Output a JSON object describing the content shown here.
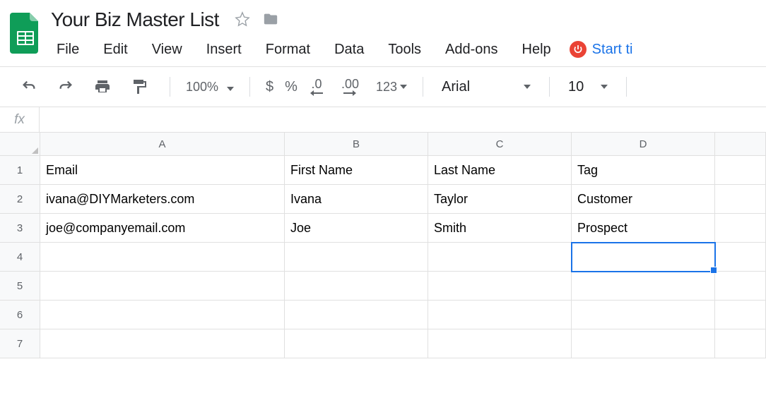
{
  "doc_title": "Your Biz Master List",
  "menubar": [
    "File",
    "Edit",
    "View",
    "Insert",
    "Format",
    "Data",
    "Tools",
    "Add-ons",
    "Help"
  ],
  "start_link": "Start ti",
  "toolbar": {
    "zoom": "100%",
    "currency": "$",
    "percent": "%",
    "dec_dec": ".0",
    "inc_dec": ".00",
    "more_fmt": "123",
    "font": "Arial",
    "size": "10"
  },
  "fx_label": "fx",
  "columns": [
    "A",
    "B",
    "C",
    "D"
  ],
  "rows": [
    "1",
    "2",
    "3",
    "4",
    "5",
    "6",
    "7"
  ],
  "sheet": {
    "r1": {
      "A": "Email",
      "B": "First Name",
      "C": "Last Name",
      "D": "Tag"
    },
    "r2": {
      "A": "ivana@DIYMarketers.com",
      "B": "Ivana",
      "C": "Taylor",
      "D": "Customer"
    },
    "r3": {
      "A": "joe@companyemail.com",
      "B": "Joe",
      "C": "Smith",
      "D": "Prospect"
    }
  },
  "selected_cell": "D4"
}
